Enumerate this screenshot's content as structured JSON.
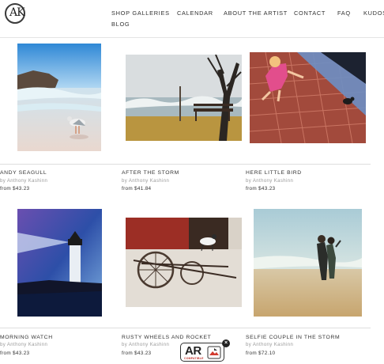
{
  "logo": {
    "text": "AK"
  },
  "nav": {
    "items": [
      "SHOP GALLERIES",
      "CALENDAR",
      "ABOUT THE ARTIST",
      "CONTACT",
      "FAQ",
      "KUDOS",
      "BLOG"
    ]
  },
  "artworks": [
    {
      "title": "ANDY SEAGULL",
      "by": "by Anthony Kashinn",
      "price": "from $43.23"
    },
    {
      "title": "AFTER THE STORM",
      "by": "by Anthony Kashinn",
      "price": "from $41.84"
    },
    {
      "title": "HERE LITTLE BIRD",
      "by": "by Anthony Kashinn",
      "price": "from $43.23"
    },
    {
      "title": "MORNING WATCH",
      "by": "by Anthony Kashinn",
      "price": "from $43.23"
    },
    {
      "title": "RUSTY WHEELS AND ROCKET",
      "by": "by Anthony Kashinn",
      "price": "from $43.23"
    },
    {
      "title": "SELFIE COUPLE IN THE STORM",
      "by": "by Anthony Kashinn",
      "price": "from $72.10"
    }
  ],
  "ar_badge": {
    "label": "AR",
    "sublabel": "COMPATIBLE",
    "close_glyph": "×"
  }
}
